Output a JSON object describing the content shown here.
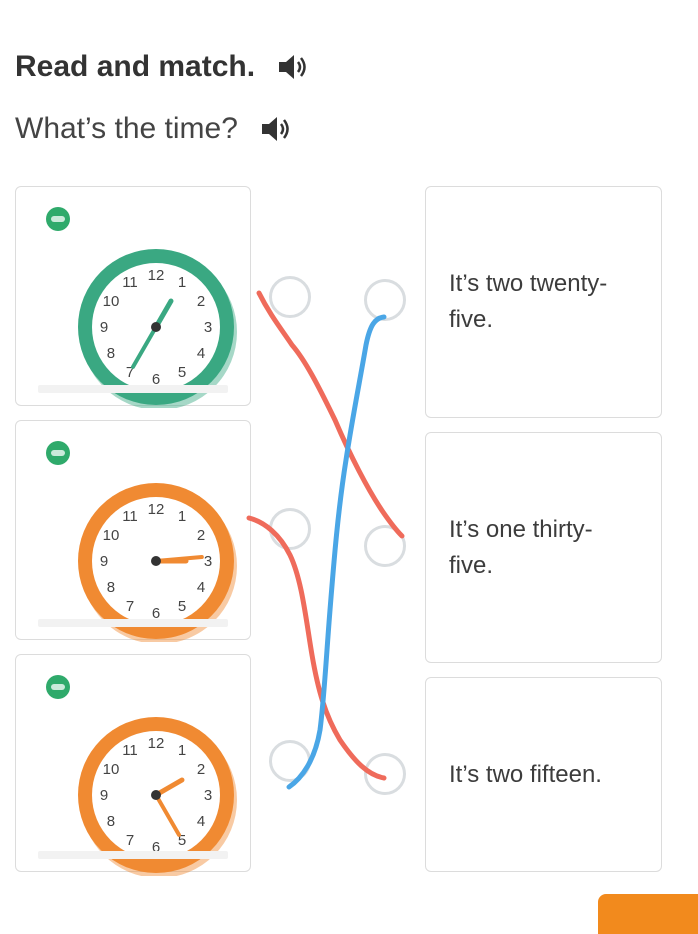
{
  "title": "Read and match.",
  "subtitle": "What’s the time?",
  "icons": {
    "audio": "speaker-icon"
  },
  "colors": {
    "green_clock": "#3aa882",
    "orange_clock": "#f08a32",
    "line_red": "#ef6b5b",
    "line_blue": "#4aa6e6",
    "next_button": "#f28a1d"
  },
  "clocks": [
    {
      "color": "green",
      "numbers": [
        "12",
        "1",
        "2",
        "3",
        "4",
        "5",
        "6",
        "7",
        "8",
        "9",
        "10",
        "11"
      ]
    },
    {
      "color": "orange",
      "numbers": [
        "12",
        "1",
        "2",
        "3",
        "4",
        "5",
        "6",
        "7",
        "8",
        "9",
        "10",
        "11"
      ]
    },
    {
      "color": "orange",
      "numbers": [
        "12",
        "1",
        "2",
        "3",
        "4",
        "5",
        "6",
        "7",
        "8",
        "9",
        "10",
        "11"
      ]
    }
  ],
  "answers": [
    {
      "label": "It’s two twenty-\nfive."
    },
    {
      "label": "It’s one thirty-\nfive."
    },
    {
      "label": "It’s two fifteen."
    }
  ]
}
